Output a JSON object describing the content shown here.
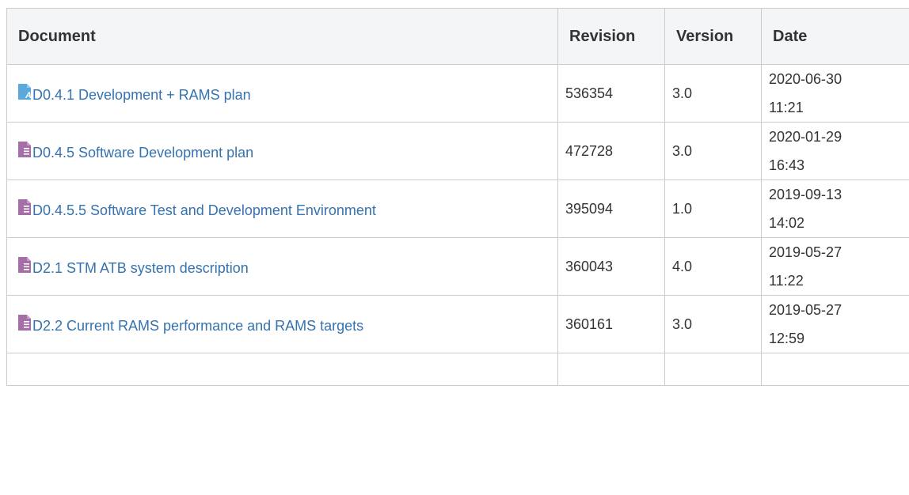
{
  "table": {
    "headers": {
      "document": "Document",
      "revision": "Revision",
      "version": "Version",
      "date": "Date"
    },
    "rows": [
      {
        "icon": "document-blue-icon",
        "title": "D0.4.1 Development + RAMS plan",
        "revision": "536354",
        "version": "3.0",
        "date": "2020-06-30",
        "time": "11:21"
      },
      {
        "icon": "document-purple-icon",
        "title": "D0.4.5 Software Development plan",
        "revision": "472728",
        "version": "3.0",
        "date": "2020-01-29",
        "time": "16:43"
      },
      {
        "icon": "document-purple-icon",
        "title": "D0.4.5.5 Software Test and Development Environment",
        "revision": "395094",
        "version": "1.0",
        "date": "2019-09-13",
        "time": "14:02"
      },
      {
        "icon": "document-purple-icon",
        "title": "D2.1 STM ATB system description",
        "revision": "360043",
        "version": "4.0",
        "date": "2019-05-27",
        "time": "11:22"
      },
      {
        "icon": "document-purple-icon",
        "title": "D2.2 Current RAMS performance and RAMS targets",
        "revision": "360161",
        "version": "3.0",
        "date": "2019-05-27",
        "time": "12:59"
      }
    ]
  },
  "colors": {
    "link": "#3572b0",
    "header_bg": "#f4f5f7",
    "border": "#cccccc",
    "icon_blue": "#5aa9db",
    "icon_purple": "#a66ea6"
  }
}
